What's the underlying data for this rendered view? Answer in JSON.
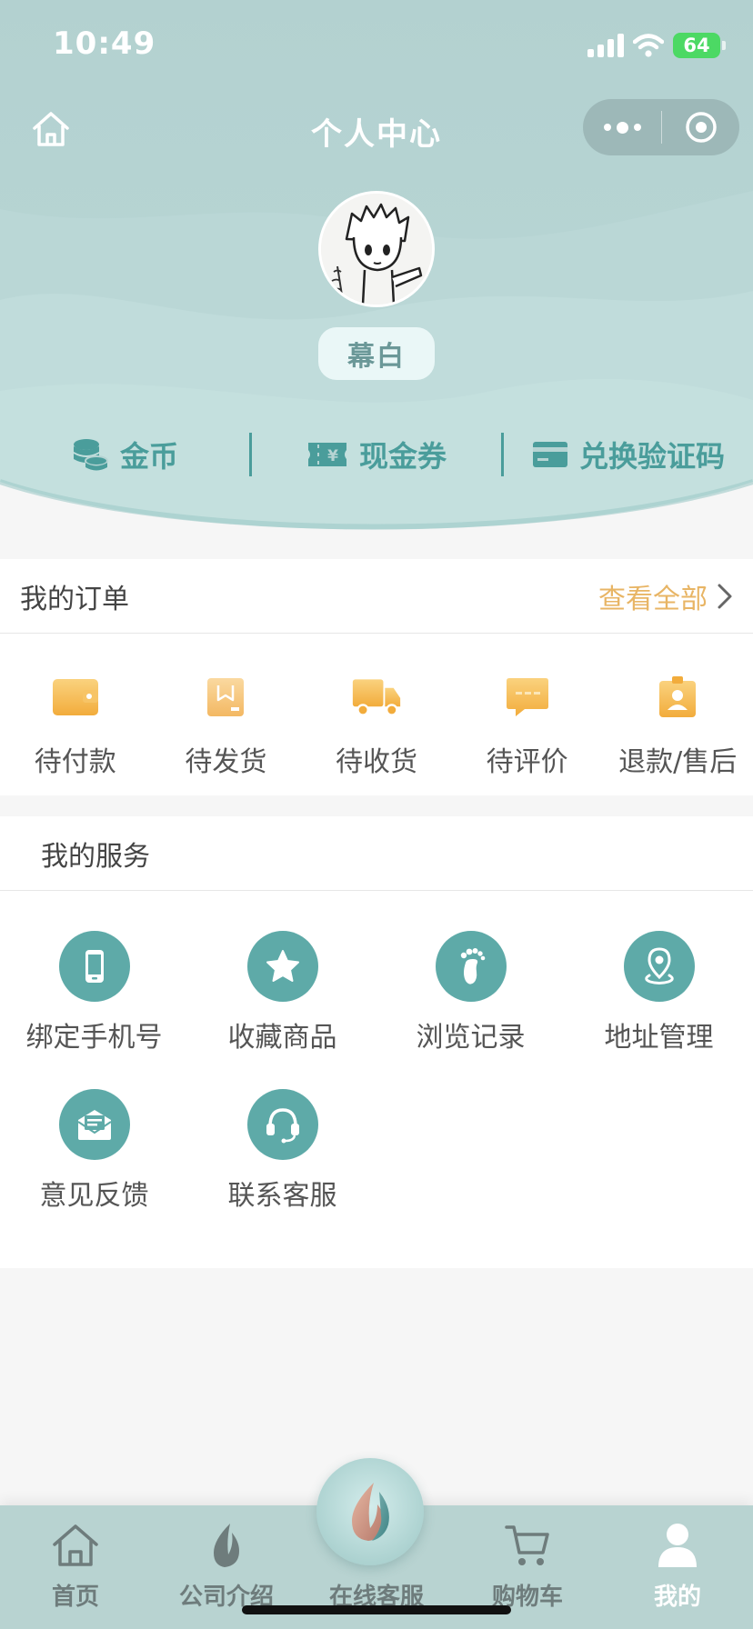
{
  "status_bar": {
    "time": "10:49",
    "battery": "64"
  },
  "nav": {
    "title": "个人中心"
  },
  "profile": {
    "nickname": "幕白"
  },
  "assets": [
    {
      "label": "金币",
      "icon": "coins-icon"
    },
    {
      "label": "现金券",
      "icon": "cash-coupon-icon"
    },
    {
      "label": "兑换验证码",
      "icon": "card-icon"
    }
  ],
  "orders": {
    "title": "我的订单",
    "view_all": "查看全部",
    "items": [
      {
        "label": "待付款",
        "icon": "wallet-icon"
      },
      {
        "label": "待发货",
        "icon": "package-icon"
      },
      {
        "label": "待收货",
        "icon": "truck-icon"
      },
      {
        "label": "待评价",
        "icon": "comment-icon"
      },
      {
        "label": "退款/售后",
        "icon": "refund-user-icon"
      }
    ]
  },
  "services": {
    "title": "我的服务",
    "items": [
      {
        "label": "绑定手机号",
        "icon": "phone-icon"
      },
      {
        "label": "收藏商品",
        "icon": "star-icon"
      },
      {
        "label": "浏览记录",
        "icon": "footprint-icon"
      },
      {
        "label": "地址管理",
        "icon": "location-icon"
      },
      {
        "label": "意见反馈",
        "icon": "feedback-mail-icon"
      },
      {
        "label": "联系客服",
        "icon": "headset-icon"
      }
    ]
  },
  "tabbar": {
    "items": [
      {
        "label": "首页",
        "icon": "home-icon"
      },
      {
        "label": "公司介绍",
        "icon": "leaf-icon"
      },
      {
        "label": "在线客服",
        "icon": "flame-leaf-icon"
      },
      {
        "label": "购物车",
        "icon": "cart-icon"
      },
      {
        "label": "我的",
        "icon": "user-icon"
      }
    ],
    "active_index": 4
  },
  "colors": {
    "header_bg": "#b3d1d0",
    "accent_teal": "#4a9d9b",
    "service_icon_bg": "#5eaaa8",
    "order_icon": "#f5be5a",
    "view_all": "#e8b565"
  }
}
